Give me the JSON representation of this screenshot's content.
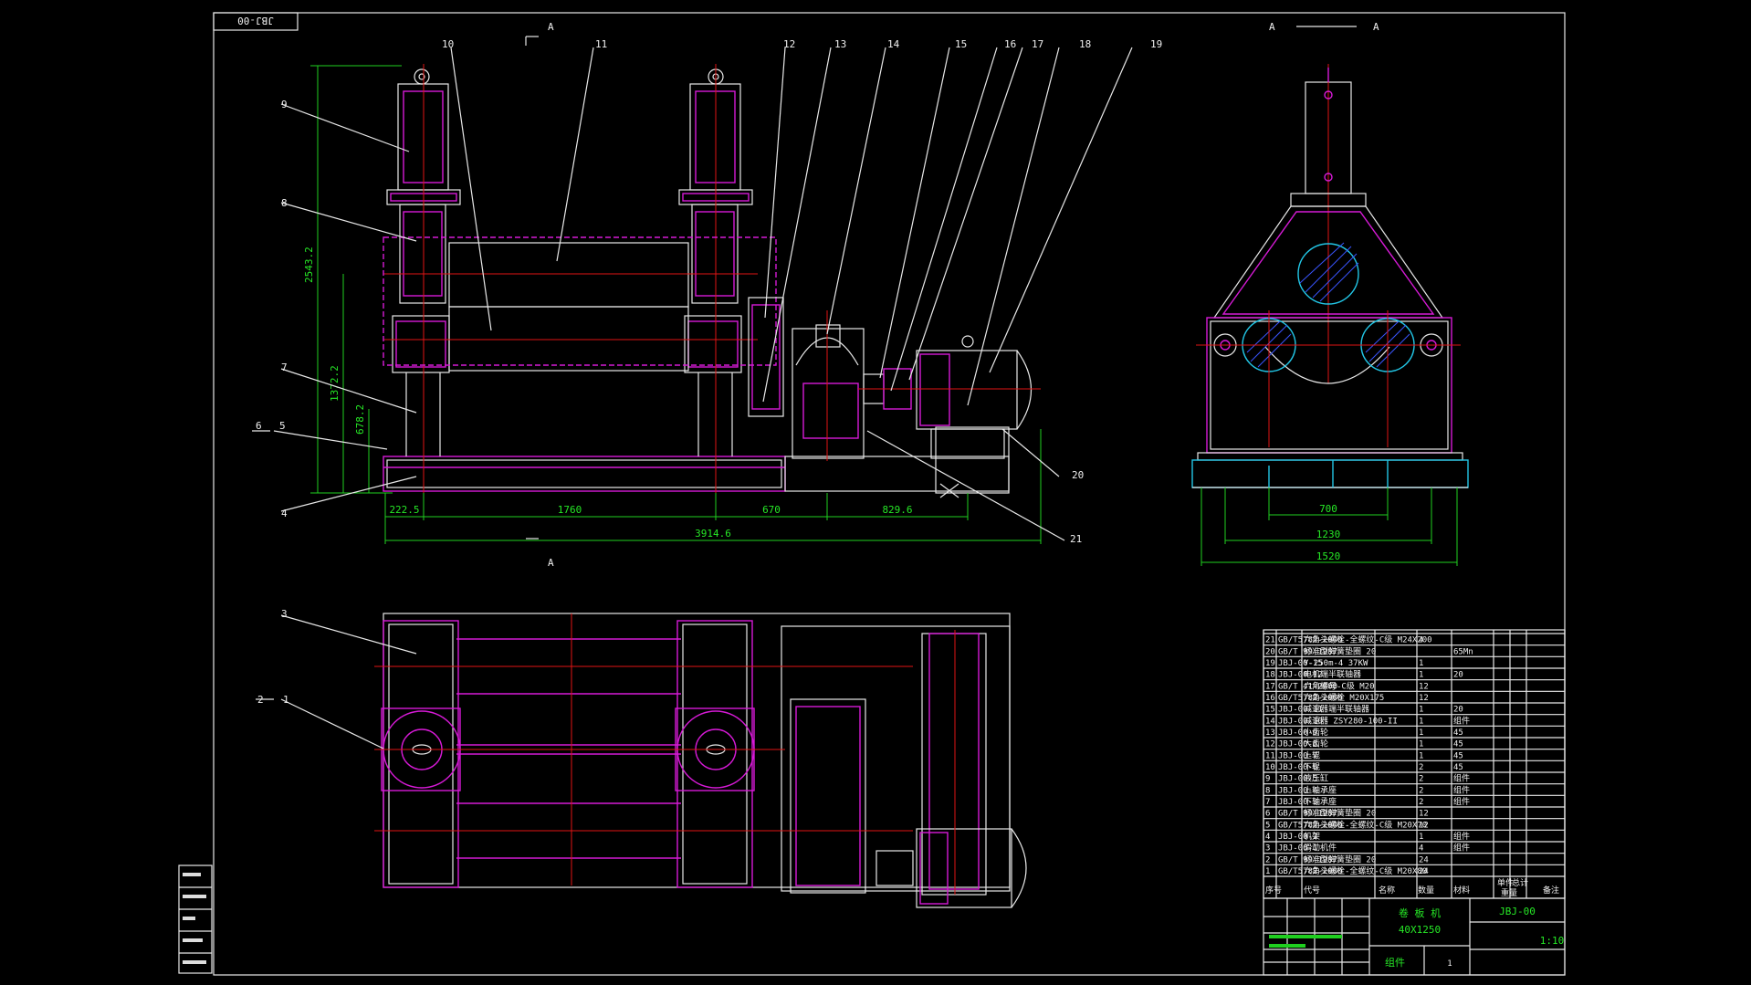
{
  "drawing_code_stamp": "JBJ-00",
  "section_marks": {
    "top": "A",
    "bottom": "A",
    "view_left": "A",
    "view_right": "A"
  },
  "part_balloons": [
    "1",
    "2",
    "3",
    "4",
    "5",
    "6",
    "7",
    "8",
    "9",
    "10",
    "11",
    "12",
    "13",
    "14",
    "15",
    "16",
    "17",
    "18",
    "19",
    "20",
    "21"
  ],
  "dimensions": {
    "overall_height": "2543.2",
    "roll_height": "1372.2",
    "lower_height": "678.2",
    "d1": "222.5",
    "d2": "1760",
    "d3": "670",
    "d4": "829.6",
    "overall_length": "3914.6",
    "side_d1": "700",
    "side_d2": "1230",
    "side_d3": "1520"
  },
  "bom": {
    "rows": [
      {
        "no": "21",
        "code": "GB/T5782-2000",
        "name": "六角头螺栓-全螺纹-C级 M24X200",
        "qty": "4",
        "mat": "",
        "note": ""
      },
      {
        "no": "20",
        "code": "GB/T 99-1987",
        "name": "标准型弹簧垫圈 20",
        "qty": "",
        "mat": "65Mn",
        "note": ""
      },
      {
        "no": "19",
        "code": "JBJ-00-15",
        "name": "Y-250m-4  37KW",
        "qty": "1",
        "mat": "",
        "note": ""
      },
      {
        "no": "18",
        "code": "JBJ-00-12",
        "name": "电机端半联轴器",
        "qty": "1",
        "mat": "20",
        "note": ""
      },
      {
        "no": "17",
        "code": "GB/T 41-2000",
        "name": "六角螺母-C级 M20",
        "qty": "12",
        "mat": "",
        "note": ""
      },
      {
        "no": "16",
        "code": "GB/T5782-2000",
        "name": "六角头螺栓 M20X175",
        "qty": "12",
        "mat": "",
        "note": ""
      },
      {
        "no": "15",
        "code": "JBJ-00-11",
        "name": "减速器端半联轴器",
        "qty": "1",
        "mat": "20",
        "note": ""
      },
      {
        "no": "14",
        "code": "JBJ-00-10",
        "name": "减速器 ZSY280-100-II",
        "qty": "1",
        "mat": "组件",
        "note": ""
      },
      {
        "no": "13",
        "code": "JBJ-00-9",
        "name": "小齿轮",
        "qty": "1",
        "mat": "45",
        "note": ""
      },
      {
        "no": "12",
        "code": "JBJ-00-8",
        "name": "大齿轮",
        "qty": "1",
        "mat": "45",
        "note": ""
      },
      {
        "no": "11",
        "code": "JBJ-00-7",
        "name": "上辊",
        "qty": "1",
        "mat": "45",
        "note": ""
      },
      {
        "no": "10",
        "code": "JBJ-00-6",
        "name": "下辊",
        "qty": "2",
        "mat": "45",
        "note": ""
      },
      {
        "no": "9",
        "code": "JBJ-00-5",
        "name": "液压缸",
        "qty": "2",
        "mat": "组件",
        "note": ""
      },
      {
        "no": "8",
        "code": "JBJ-00-4",
        "name": "上轴承座",
        "qty": "2",
        "mat": "组件",
        "note": ""
      },
      {
        "no": "7",
        "code": "JBJ-00-3",
        "name": "下轴承座",
        "qty": "2",
        "mat": "组件",
        "note": ""
      },
      {
        "no": "6",
        "code": "GB/T 99-1987",
        "name": "标准型弹簧垫圈 20",
        "qty": "12",
        "mat": "",
        "note": ""
      },
      {
        "no": "5",
        "code": "GB/T5782-2000",
        "name": "六角头螺栓-全螺纹-C级 M20X70",
        "qty": "12",
        "mat": "",
        "note": ""
      },
      {
        "no": "4",
        "code": "JBJ-00-2",
        "name": "机架",
        "qty": "1",
        "mat": "组件",
        "note": ""
      },
      {
        "no": "3",
        "code": "JBJ-00-1",
        "name": "滑动机件",
        "qty": "4",
        "mat": "组件",
        "note": ""
      },
      {
        "no": "2",
        "code": "GB/T 99-1987",
        "name": "标准型弹簧垫圈 20",
        "qty": "24",
        "mat": "",
        "note": ""
      },
      {
        "no": "1",
        "code": "GB/T5782-2000",
        "name": "六角头螺栓-全螺纹-C级 M20X80",
        "qty": "24",
        "mat": "",
        "note": ""
      }
    ],
    "header": {
      "no": "序号",
      "code": "代号",
      "name": "名称",
      "qty": "数量",
      "mat": "材料",
      "unit_weight": "单件",
      "total_weight": "总计",
      "weight": "重量",
      "note": "备注"
    }
  },
  "title_block": {
    "machine_name": "卷 板 机",
    "spec": "40X1250",
    "drawing_no": "JBJ-00",
    "type": "组件",
    "sheet": "1",
    "scale": "1:10"
  },
  "colors": {
    "background": "#000000",
    "outline": "#e8e8e8",
    "hidden_parts": "#d61ad6",
    "centerlines": "#e01515",
    "dimensions": "#1fcf1f",
    "section_outline": "#22c6e6",
    "section_hatch": "#3a55ff"
  }
}
